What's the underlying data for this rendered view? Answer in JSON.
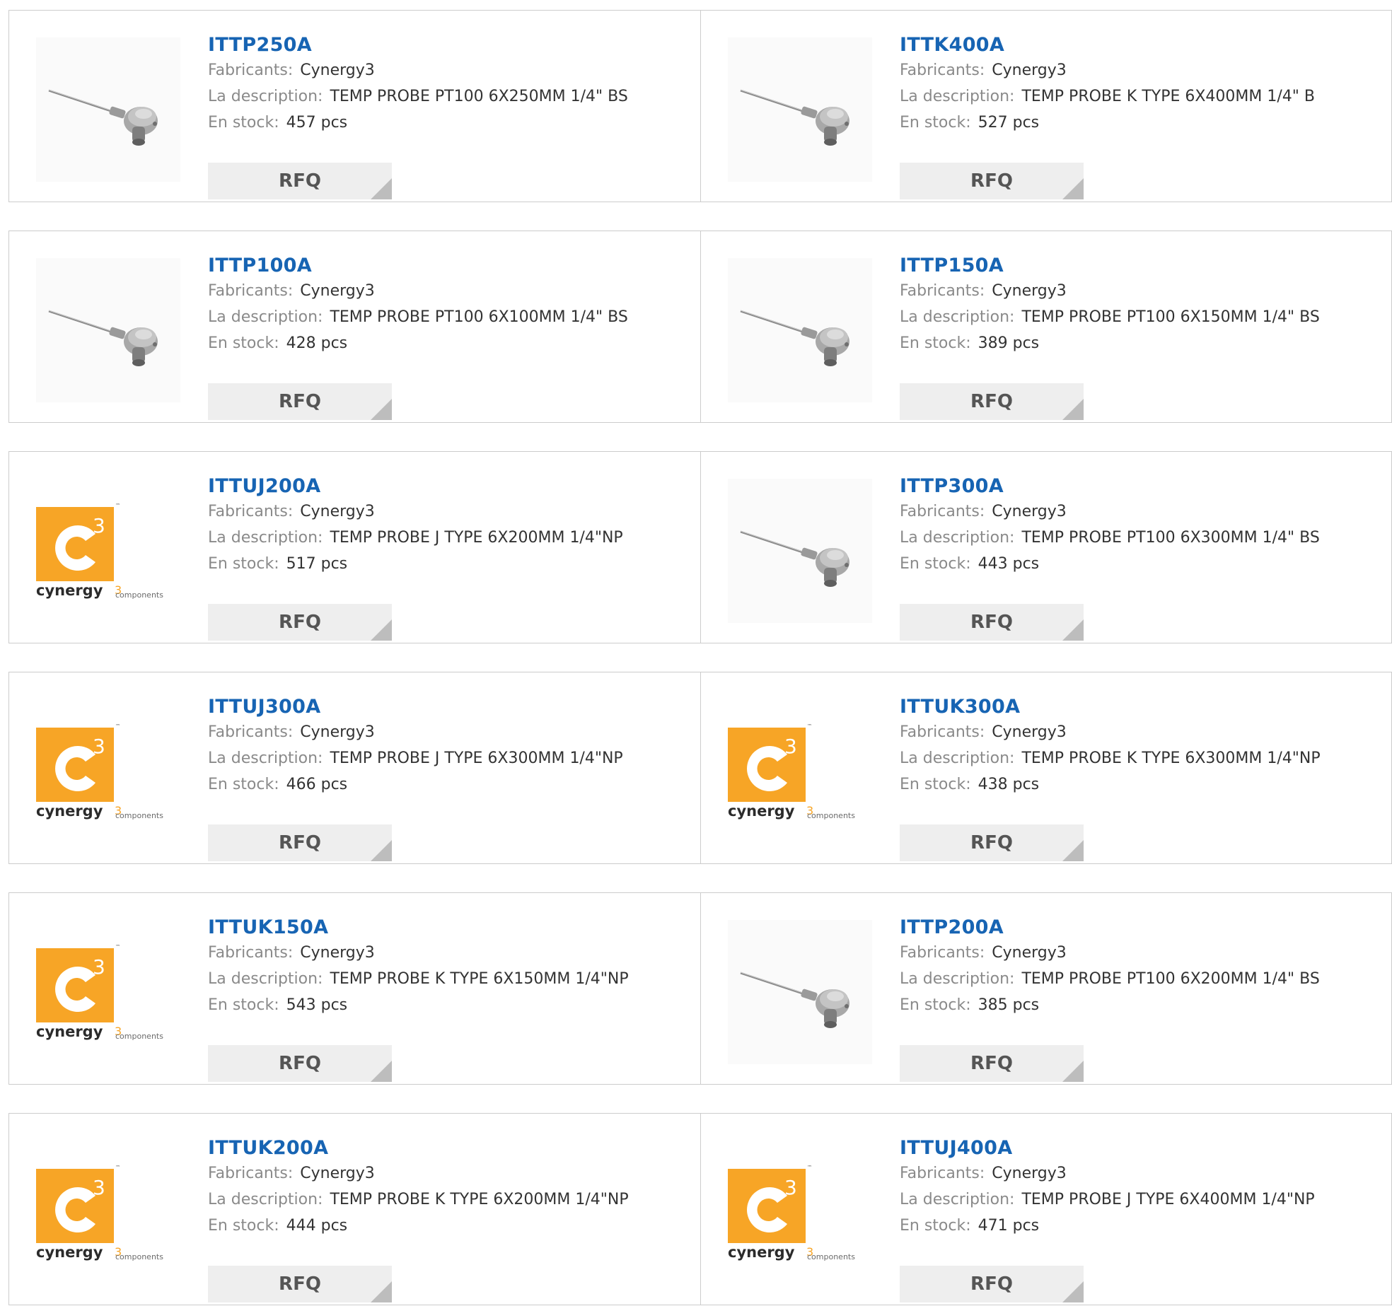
{
  "labels": {
    "manufacturer": "Fabricants:",
    "description": "La description:",
    "stock": "En stock:",
    "rfq": "RFQ"
  },
  "colors": {
    "link": "#1764b3",
    "logo_orange": "#f7a526",
    "button_bg": "#eeeeee"
  },
  "products": [
    {
      "part": "ITTP250A",
      "manufacturer": "Cynergy3",
      "description": "TEMP PROBE PT100 6X250MM 1/4\" BS",
      "stock": "457 pcs",
      "image": "probe-image"
    },
    {
      "part": "ITTK400A",
      "manufacturer": "Cynergy3",
      "description": "TEMP PROBE K TYPE 6X400MM 1/4\" B",
      "stock": "527 pcs",
      "image": "probe-image"
    },
    {
      "part": "ITTP100A",
      "manufacturer": "Cynergy3",
      "description": "TEMP PROBE PT100 6X100MM 1/4\" BS",
      "stock": "428 pcs",
      "image": "probe-image"
    },
    {
      "part": "ITTP150A",
      "manufacturer": "Cynergy3",
      "description": "TEMP PROBE PT100 6X150MM 1/4\" BS",
      "stock": "389 pcs",
      "image": "probe-image"
    },
    {
      "part": "ITTUJ200A",
      "manufacturer": "Cynergy3",
      "description": "TEMP PROBE J TYPE 6X200MM 1/4\"NP",
      "stock": "517 pcs",
      "image": "cynergy3-logo"
    },
    {
      "part": "ITTP300A",
      "manufacturer": "Cynergy3",
      "description": "TEMP PROBE PT100 6X300MM 1/4\" BS",
      "stock": "443 pcs",
      "image": "probe-image"
    },
    {
      "part": "ITTUJ300A",
      "manufacturer": "Cynergy3",
      "description": "TEMP PROBE J TYPE 6X300MM 1/4\"NP",
      "stock": "466 pcs",
      "image": "cynergy3-logo"
    },
    {
      "part": "ITTUK300A",
      "manufacturer": "Cynergy3",
      "description": "TEMP PROBE K TYPE 6X300MM 1/4\"NP",
      "stock": "438 pcs",
      "image": "cynergy3-logo"
    },
    {
      "part": "ITTUK150A",
      "manufacturer": "Cynergy3",
      "description": "TEMP PROBE K TYPE 6X150MM 1/4\"NP",
      "stock": "543 pcs",
      "image": "cynergy3-logo"
    },
    {
      "part": "ITTP200A",
      "manufacturer": "Cynergy3",
      "description": "TEMP PROBE PT100 6X200MM 1/4\" BS",
      "stock": "385 pcs",
      "image": "probe-image"
    },
    {
      "part": "ITTUK200A",
      "manufacturer": "Cynergy3",
      "description": "TEMP PROBE K TYPE 6X200MM 1/4\"NP",
      "stock": "444 pcs",
      "image": "cynergy3-logo"
    },
    {
      "part": "ITTUJ400A",
      "manufacturer": "Cynergy3",
      "description": "TEMP PROBE J TYPE 6X400MM 1/4\"NP",
      "stock": "471 pcs",
      "image": "cynergy3-logo"
    }
  ],
  "logo_text": {
    "brand": "cynergy",
    "superscript": "3",
    "sub": "components",
    "tm": "™"
  }
}
